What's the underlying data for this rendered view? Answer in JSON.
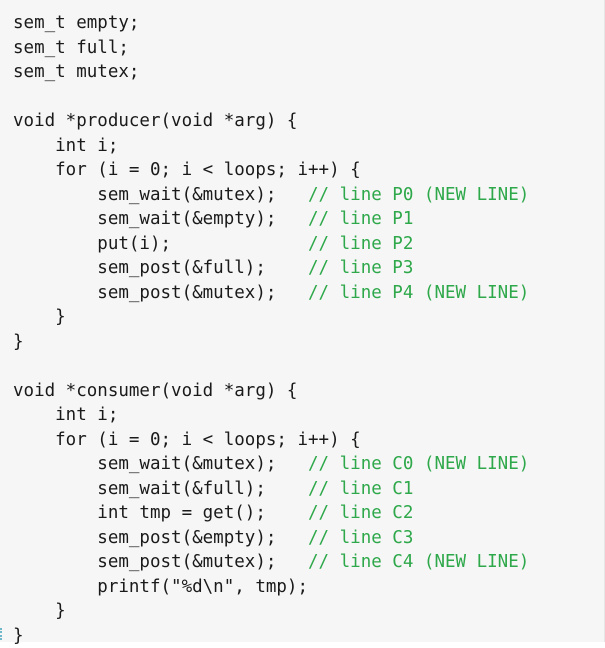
{
  "code_lines": [
    {
      "code": "sem_t empty;",
      "comment": ""
    },
    {
      "code": "sem_t full;",
      "comment": ""
    },
    {
      "code": "sem_t mutex;",
      "comment": ""
    },
    {
      "code": "",
      "comment": ""
    },
    {
      "code": "void *producer(void *arg) {",
      "comment": ""
    },
    {
      "code": "    int i;",
      "comment": ""
    },
    {
      "code": "    for (i = 0; i < loops; i++) {",
      "comment": ""
    },
    {
      "code": "        sem_wait(&mutex);   ",
      "comment": "// line P0 (NEW LINE)"
    },
    {
      "code": "        sem_wait(&empty);   ",
      "comment": "// line P1"
    },
    {
      "code": "        put(i);             ",
      "comment": "// line P2"
    },
    {
      "code": "        sem_post(&full);    ",
      "comment": "// line P3"
    },
    {
      "code": "        sem_post(&mutex);   ",
      "comment": "// line P4 (NEW LINE)"
    },
    {
      "code": "    }",
      "comment": ""
    },
    {
      "code": "}",
      "comment": ""
    },
    {
      "code": "",
      "comment": ""
    },
    {
      "code": "void *consumer(void *arg) {",
      "comment": ""
    },
    {
      "code": "    int i;",
      "comment": ""
    },
    {
      "code": "    for (i = 0; i < loops; i++) {",
      "comment": ""
    },
    {
      "code": "        sem_wait(&mutex);   ",
      "comment": "// line C0 (NEW LINE)"
    },
    {
      "code": "        sem_wait(&full);    ",
      "comment": "// line C1"
    },
    {
      "code": "        int tmp = get();    ",
      "comment": "// line C2"
    },
    {
      "code": "        sem_post(&empty);   ",
      "comment": "// line C3"
    },
    {
      "code": "        sem_post(&mutex);   ",
      "comment": "// line C4 (NEW LINE)"
    },
    {
      "code": "        printf(\"%d\\n\", tmp);",
      "comment": ""
    },
    {
      "code": "    }",
      "comment": ""
    },
    {
      "code": "}",
      "comment": ""
    }
  ],
  "colors": {
    "text": "#1a1a1a",
    "comment": "#2ea84a",
    "background": "#f6f6f6"
  }
}
